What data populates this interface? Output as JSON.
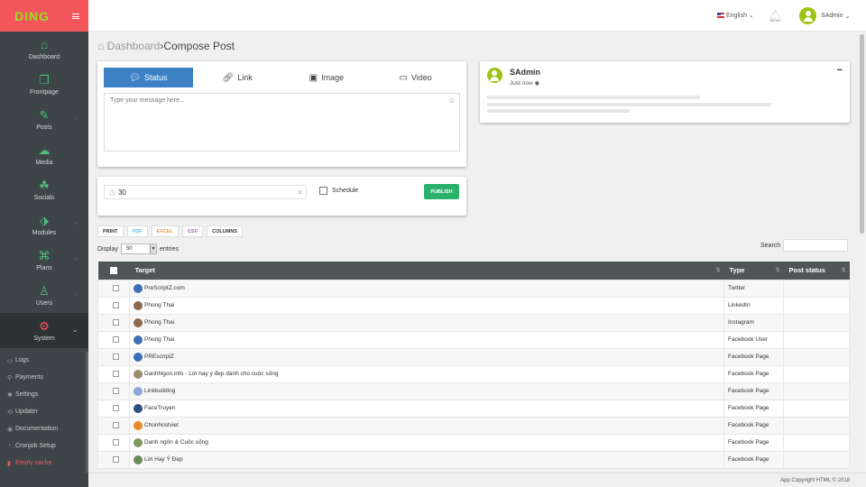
{
  "app": {
    "logo": "DING",
    "accent": "#f2555a",
    "green": "#2ab26d"
  },
  "sidebar": {
    "items": [
      {
        "label": "Dashboard",
        "icon": "dashboard-icon",
        "glyph": "⌂"
      },
      {
        "label": "Frontpage",
        "icon": "frontpage-icon",
        "glyph": "❐"
      },
      {
        "label": "Posts",
        "icon": "posts-icon",
        "glyph": "✎"
      },
      {
        "label": "Media",
        "icon": "cloud-icon",
        "glyph": "☁"
      },
      {
        "label": "Socials",
        "icon": "socials-icon",
        "glyph": "☘"
      },
      {
        "label": "Modules",
        "icon": "modules-icon",
        "glyph": "⬗"
      },
      {
        "label": "Plans",
        "icon": "gift-icon",
        "glyph": "⌘"
      },
      {
        "label": "Users",
        "icon": "users-icon",
        "glyph": "♙"
      },
      {
        "label": "System",
        "icon": "gear-icon",
        "glyph": "⚙"
      }
    ],
    "subitems": [
      {
        "label": "Logs",
        "glyph": "▭"
      },
      {
        "label": "Payments",
        "glyph": "⚲"
      },
      {
        "label": "Settings",
        "glyph": "✱"
      },
      {
        "label": "Updater",
        "glyph": "⟲"
      },
      {
        "label": "Documentation",
        "glyph": "◉"
      },
      {
        "label": "Cronjob Setup",
        "glyph": "◔"
      },
      {
        "label": "Empty cache",
        "glyph": "▮"
      }
    ]
  },
  "topbar": {
    "language": "English",
    "user": "SAdmin"
  },
  "breadcrumb": {
    "home": "Dashboard",
    "separator": "›",
    "current": "Compose Post"
  },
  "composer": {
    "tabs": [
      "Status",
      "Link",
      "Image",
      "Video"
    ],
    "message_placeholder": "Type your message here...",
    "interval": "30",
    "schedule_label": "Schedule",
    "publish_label": "PUBLISH"
  },
  "preview": {
    "name": "SAdmin",
    "time": "Just now"
  },
  "toolbar": {
    "buttons": [
      "PRINT",
      "PDF",
      "EXCEL",
      "CSV",
      "COLUMNS"
    ]
  },
  "table_controls": {
    "display_label": "Display",
    "entries_value": "50",
    "entries_label": "entries",
    "search_label": "Search"
  },
  "table": {
    "headers": [
      "Target",
      "Type",
      "Post status"
    ],
    "rows": [
      {
        "target": "PreScriptZ.com",
        "type": "Twitter",
        "color": "#3b6fb5"
      },
      {
        "target": "Phong Thai",
        "type": "LinkedIn",
        "color": "#8b6a4e"
      },
      {
        "target": "Phong Thai",
        "type": "Instagram",
        "color": "#8b6a4e"
      },
      {
        "target": "Phong Thai",
        "type": "Facebook User",
        "color": "#3b6fb5"
      },
      {
        "target": "PREscriptZ",
        "type": "Facebook Page",
        "color": "#3b6fb5"
      },
      {
        "target": "DanhNgon.info - Lời hay ý đẹp dành cho cuộc sống",
        "type": "Facebook Page",
        "color": "#9a8f70"
      },
      {
        "target": "Linkbuilding",
        "type": "Facebook Page",
        "color": "#8aa6d8"
      },
      {
        "target": "FaceTruyen",
        "type": "Facebook Page",
        "color": "#2c4d86"
      },
      {
        "target": "Chonhostviet",
        "type": "Facebook Page",
        "color": "#e58a2a"
      },
      {
        "target": "Danh ngôn & Cuộc sống",
        "type": "Facebook Page",
        "color": "#7c9a5a"
      },
      {
        "target": "Lời Hay Ý Đẹp",
        "type": "Facebook Page",
        "color": "#6c8c5a"
      }
    ]
  },
  "footer": "App Copyright HTML © 2018"
}
